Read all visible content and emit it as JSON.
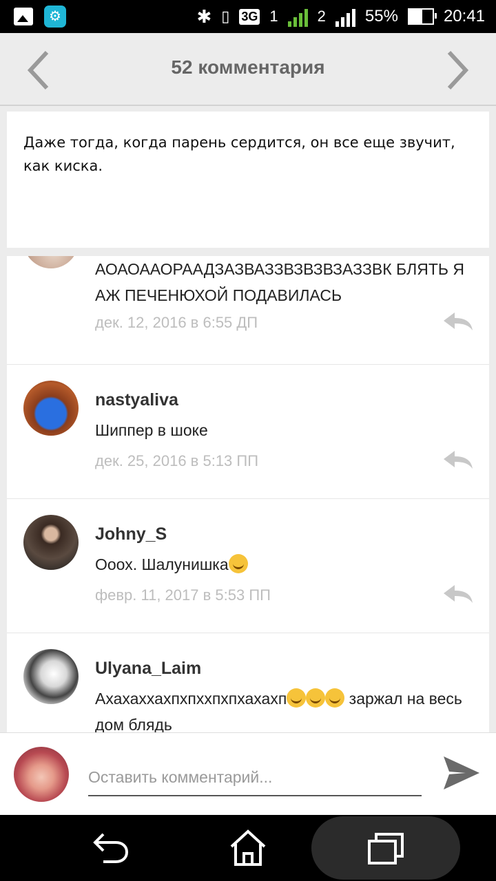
{
  "status_bar": {
    "network": "3G",
    "sim1": "1",
    "sim2": "2",
    "battery": "55%",
    "time": "20:41"
  },
  "header": {
    "title": "52 комментария"
  },
  "post": {
    "text": "Даже тогда, когда парень сердится, он все еще звучит, как киска."
  },
  "comments": [
    {
      "username": "",
      "text": "АОАОААОРААДЗАЗВАЗЗВЗВЗВЗАЗЗВК БЛЯТЬ Я АЖ ПЕЧЕНЮХОЙ ПОДАВИЛАСЬ",
      "date": "дек. 12, 2016 в 6:55 ДП"
    },
    {
      "username": "nastyaliva",
      "text": "Шиппер в шоке",
      "date": "дек. 25, 2016 в 5:13 ПП"
    },
    {
      "username": "Johny_S",
      "text": "Ооох. Шалунишка",
      "date": "февр. 11, 2017 в 5:53 ПП"
    },
    {
      "username": "Ulyana_Laim",
      "text_before": "Ахахаххахпхпххпхпхахахп",
      "text_after": " заржал на весь дом блядь",
      "date": ""
    }
  ],
  "compose": {
    "placeholder": "Оставить комментарий..."
  },
  "icons": {
    "prev": "chevron-left-icon",
    "next": "chevron-right-icon",
    "reply": "reply-icon",
    "send": "send-icon",
    "back": "back-icon",
    "home": "home-icon",
    "recents": "recents-icon"
  },
  "colors": {
    "header_bg": "#ececec",
    "title": "#666666",
    "date": "#bdbdbd",
    "app_icon": "#1fb6d6"
  }
}
